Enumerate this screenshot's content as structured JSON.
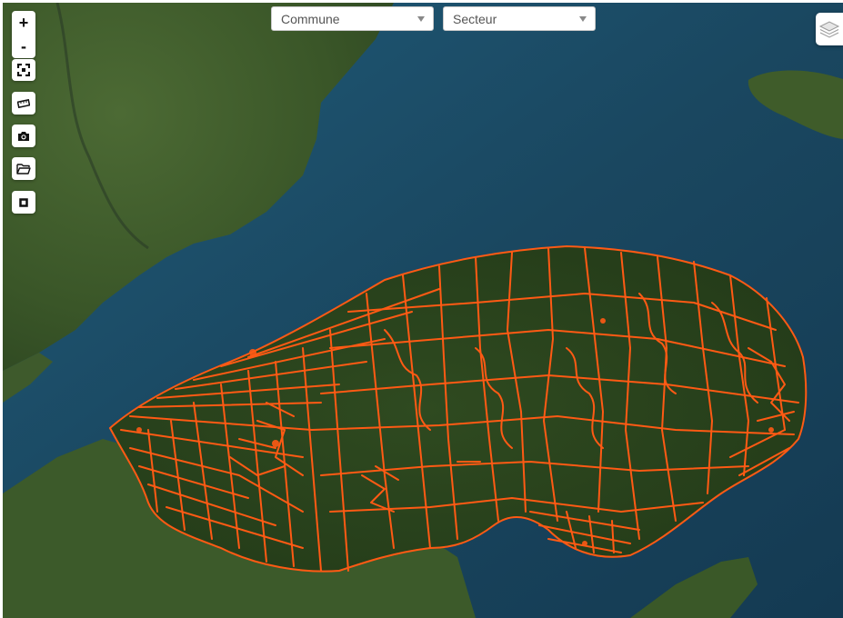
{
  "filters": {
    "commune_label": "Commune",
    "secteur_label": "Secteur"
  },
  "controls": {
    "zoom_in": "+",
    "zoom_out": "-"
  },
  "colors": {
    "road_network": "#ff5a14",
    "water": "#1d4a62",
    "forest": "#2e4a22"
  },
  "icons": {
    "fullscreen": "fullscreen-icon",
    "measure": "ruler-icon",
    "screenshot": "camera-icon",
    "open": "folder-icon",
    "select": "square-icon",
    "layers": "layers-icon"
  }
}
